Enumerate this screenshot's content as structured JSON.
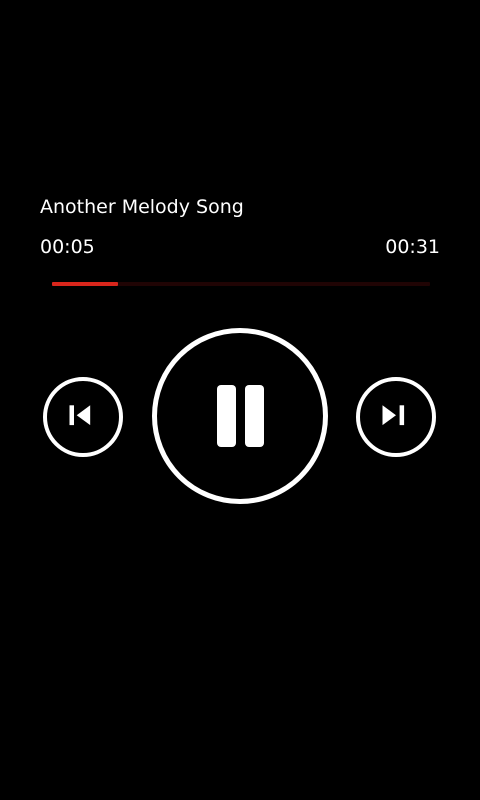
{
  "track": {
    "title": "Another Melody Song",
    "elapsed": "00:05",
    "total": "00:31"
  },
  "progress": {
    "fraction": 0.174,
    "color": "#d9261c"
  },
  "controls": {
    "previous_icon": "skip-previous-icon",
    "pause_icon": "pause-icon",
    "next_icon": "skip-next-icon"
  }
}
